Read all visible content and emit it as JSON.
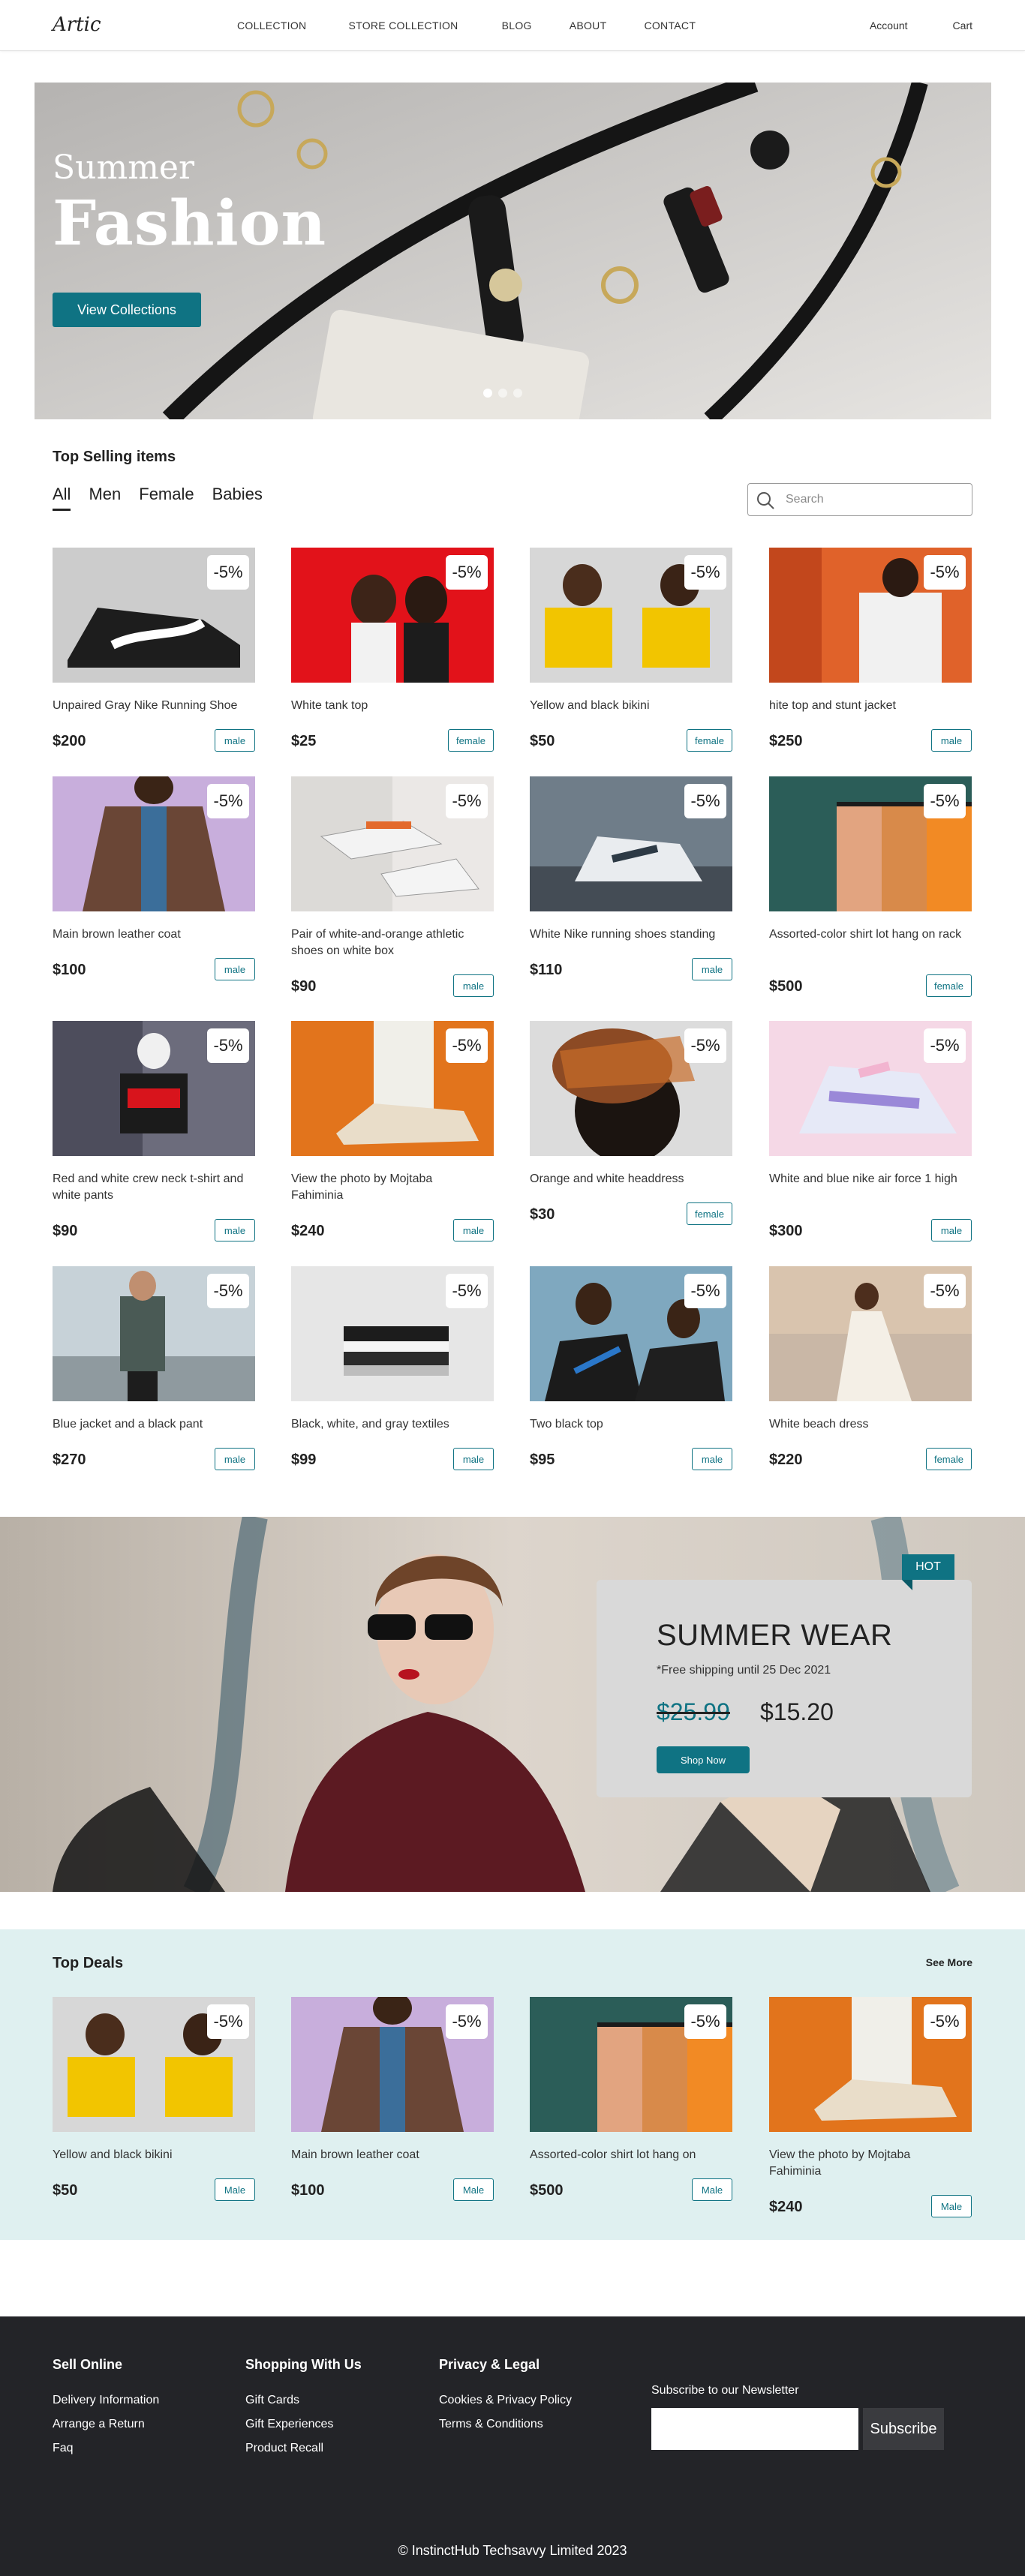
{
  "nav": {
    "logo": "Artic",
    "links": [
      "COLLECTION",
      "STORE COLLECTION",
      "BLOG",
      "ABOUT",
      "CONTACT"
    ],
    "right": [
      "Account",
      "Cart"
    ]
  },
  "hero": {
    "subtitle": "Summer",
    "title": "Fashion",
    "button": "View Collections",
    "slides": 3,
    "active_slide": 1
  },
  "top_selling": {
    "title": "Top Selling items",
    "tabs": [
      "All",
      "Men",
      "Female",
      "Babies"
    ],
    "active_tab": "All",
    "search_placeholder": "Search",
    "products": [
      {
        "name": "Unpaired Gray Nike Running Shoe",
        "price": "$200",
        "tag": "male",
        "discount": "-5%"
      },
      {
        "name": "White tank top",
        "price": "$25",
        "tag": "female",
        "discount": "-5%"
      },
      {
        "name": "Yellow and black bikini",
        "price": "$50",
        "tag": "female",
        "discount": "-5%"
      },
      {
        "name": "hite top and stunt jacket",
        "price": "$250",
        "tag": "male",
        "discount": "-5%"
      },
      {
        "name": "Main brown leather coat",
        "price": "$100",
        "tag": "male",
        "discount": "-5%"
      },
      {
        "name": "Pair of white-and-orange athletic shoes on white box",
        "price": "$90",
        "tag": "male",
        "discount": "-5%"
      },
      {
        "name": "White Nike running shoes standing",
        "price": "$110",
        "tag": "male",
        "discount": "-5%"
      },
      {
        "name": "Assorted-color shirt lot hang on rack",
        "price": "$500",
        "tag": "female",
        "discount": "-5%"
      },
      {
        "name": "Red and white crew neck t-shirt and white pants",
        "price": "$90",
        "tag": "male",
        "discount": "-5%"
      },
      {
        "name": "View the photo by Mojtaba Fahiminia",
        "price": "$240",
        "tag": "male",
        "discount": "-5%"
      },
      {
        "name": "Orange and white headdress",
        "price": "$30",
        "tag": "female",
        "discount": "-5%"
      },
      {
        "name": "White and blue nike air force 1 high",
        "price": "$300",
        "tag": "male",
        "discount": "-5%"
      },
      {
        "name": "Blue jacket and a black pant",
        "price": "$270",
        "tag": "male",
        "discount": "-5%"
      },
      {
        "name": "Black, white, and gray textiles",
        "price": "$99",
        "tag": "male",
        "discount": "-5%"
      },
      {
        "name": "Two black top",
        "price": "$95",
        "tag": "male",
        "discount": "-5%"
      },
      {
        "name": "White beach dress",
        "price": "$220",
        "tag": "female",
        "discount": "-5%"
      }
    ]
  },
  "promo": {
    "badge": "HOT",
    "title": "SUMMER WEAR",
    "shipping": "*Free shipping until 25 Dec 2021",
    "old_price": "$25.99",
    "new_price": "$15.20",
    "button": "Shop Now"
  },
  "deals": {
    "title": "Top Deals",
    "see_more": "See More",
    "products": [
      {
        "name": "Yellow and black bikini",
        "price": "$50",
        "tag": "Male",
        "discount": "-5%"
      },
      {
        "name": "Main brown leather coat",
        "price": "$100",
        "tag": "Male",
        "discount": "-5%"
      },
      {
        "name": "Assorted-color shirt lot hang on",
        "price": "$500",
        "tag": "Male",
        "discount": "-5%"
      },
      {
        "name": "View the photo by Mojtaba Fahiminia",
        "price": "$240",
        "tag": "Male",
        "discount": "-5%"
      }
    ]
  },
  "footer": {
    "columns": [
      {
        "title": "Sell Online",
        "links": [
          "Delivery Information",
          "Arrange a Return",
          "Faq"
        ]
      },
      {
        "title": "Shopping With Us",
        "links": [
          "Gift Cards",
          "Gift Experiences",
          "Product Recall"
        ]
      },
      {
        "title": "Privacy & Legal",
        "links": [
          "Cookies & Privacy Policy",
          "Terms & Conditions"
        ]
      }
    ],
    "newsletter_label": "Subscribe to our Newsletter",
    "subscribe": "Subscribe",
    "copyright": "© InstinctHub Techsavvy Limited  2023"
  },
  "colors": {
    "accent": "#0f7383",
    "footer_bg": "#232428",
    "deals_bg": "#dff0f0"
  }
}
